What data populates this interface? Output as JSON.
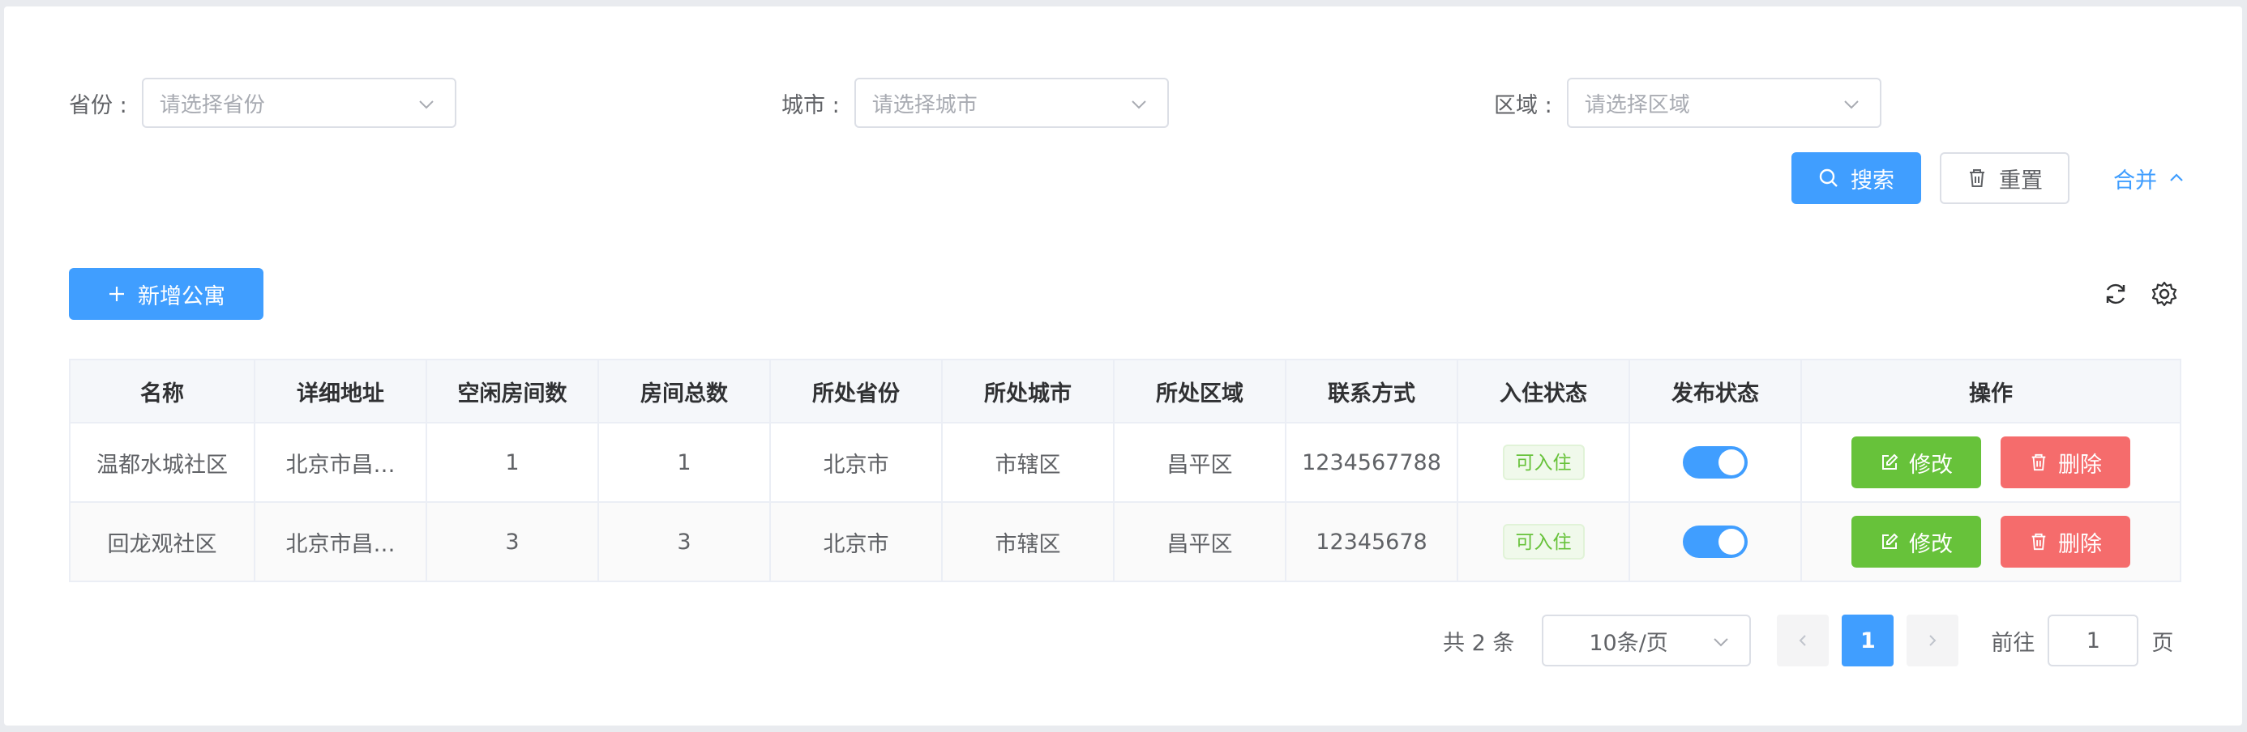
{
  "filters": {
    "province": {
      "label": "省份 :",
      "placeholder": "请选择省份"
    },
    "city": {
      "label": "城市 :",
      "placeholder": "请选择城市"
    },
    "area": {
      "label": "区域 :",
      "placeholder": "请选择区域"
    }
  },
  "actions": {
    "search": "搜索",
    "reset": "重置",
    "collapse": "合并"
  },
  "toolbar": {
    "add": "新增公寓"
  },
  "table": {
    "columns": [
      "名称",
      "详细地址",
      "空闲房间数",
      "房间总数",
      "所处省份",
      "所处城市",
      "所处区域",
      "联系方式",
      "入住状态",
      "发布状态",
      "操作"
    ],
    "rows": [
      {
        "name": "温都水城社区",
        "address": "北京市昌…",
        "free_rooms": "1",
        "total_rooms": "1",
        "province": "北京市",
        "city": "市辖区",
        "area": "昌平区",
        "phone": "1234567788",
        "status": "可入住",
        "published": true
      },
      {
        "name": "回龙观社区",
        "address": "北京市昌…",
        "free_rooms": "3",
        "total_rooms": "3",
        "province": "北京市",
        "city": "市辖区",
        "area": "昌平区",
        "phone": "12345678",
        "status": "可入住",
        "published": true
      }
    ],
    "edit_label": "修改",
    "delete_label": "删除"
  },
  "pagination": {
    "total_text": "共 2 条",
    "page_size": "10条/页",
    "current_page": "1",
    "goto_prefix": "前往",
    "goto_value": "1",
    "goto_suffix": "页"
  },
  "colors": {
    "primary": "#409eff",
    "success": "#67c23a",
    "danger": "#f56c6c"
  }
}
